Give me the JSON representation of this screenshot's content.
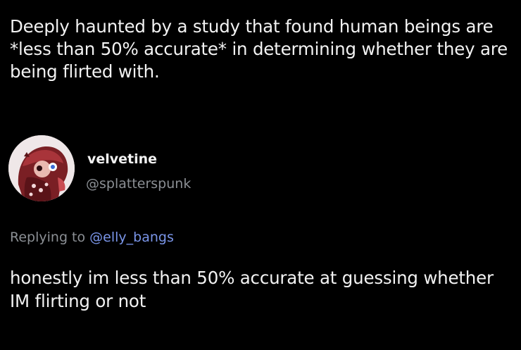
{
  "original_post": {
    "text": "Deeply haunted by a study that found human beings are *less than 50% accurate* in determining whether they are being flirted with."
  },
  "reply": {
    "display_name": "velvetine",
    "handle": "@splatterspunk",
    "replying_to_label": "Replying to ",
    "replying_to_handle": "@elly_bangs",
    "text": "honestly im less than 50% accurate at guessing whether IM flirting or not"
  },
  "colors": {
    "background": "#000000",
    "text": "#f2f2f2",
    "secondary": "#8b8f94",
    "link": "#7a95e8"
  },
  "icons": {
    "avatar": "avatar"
  }
}
